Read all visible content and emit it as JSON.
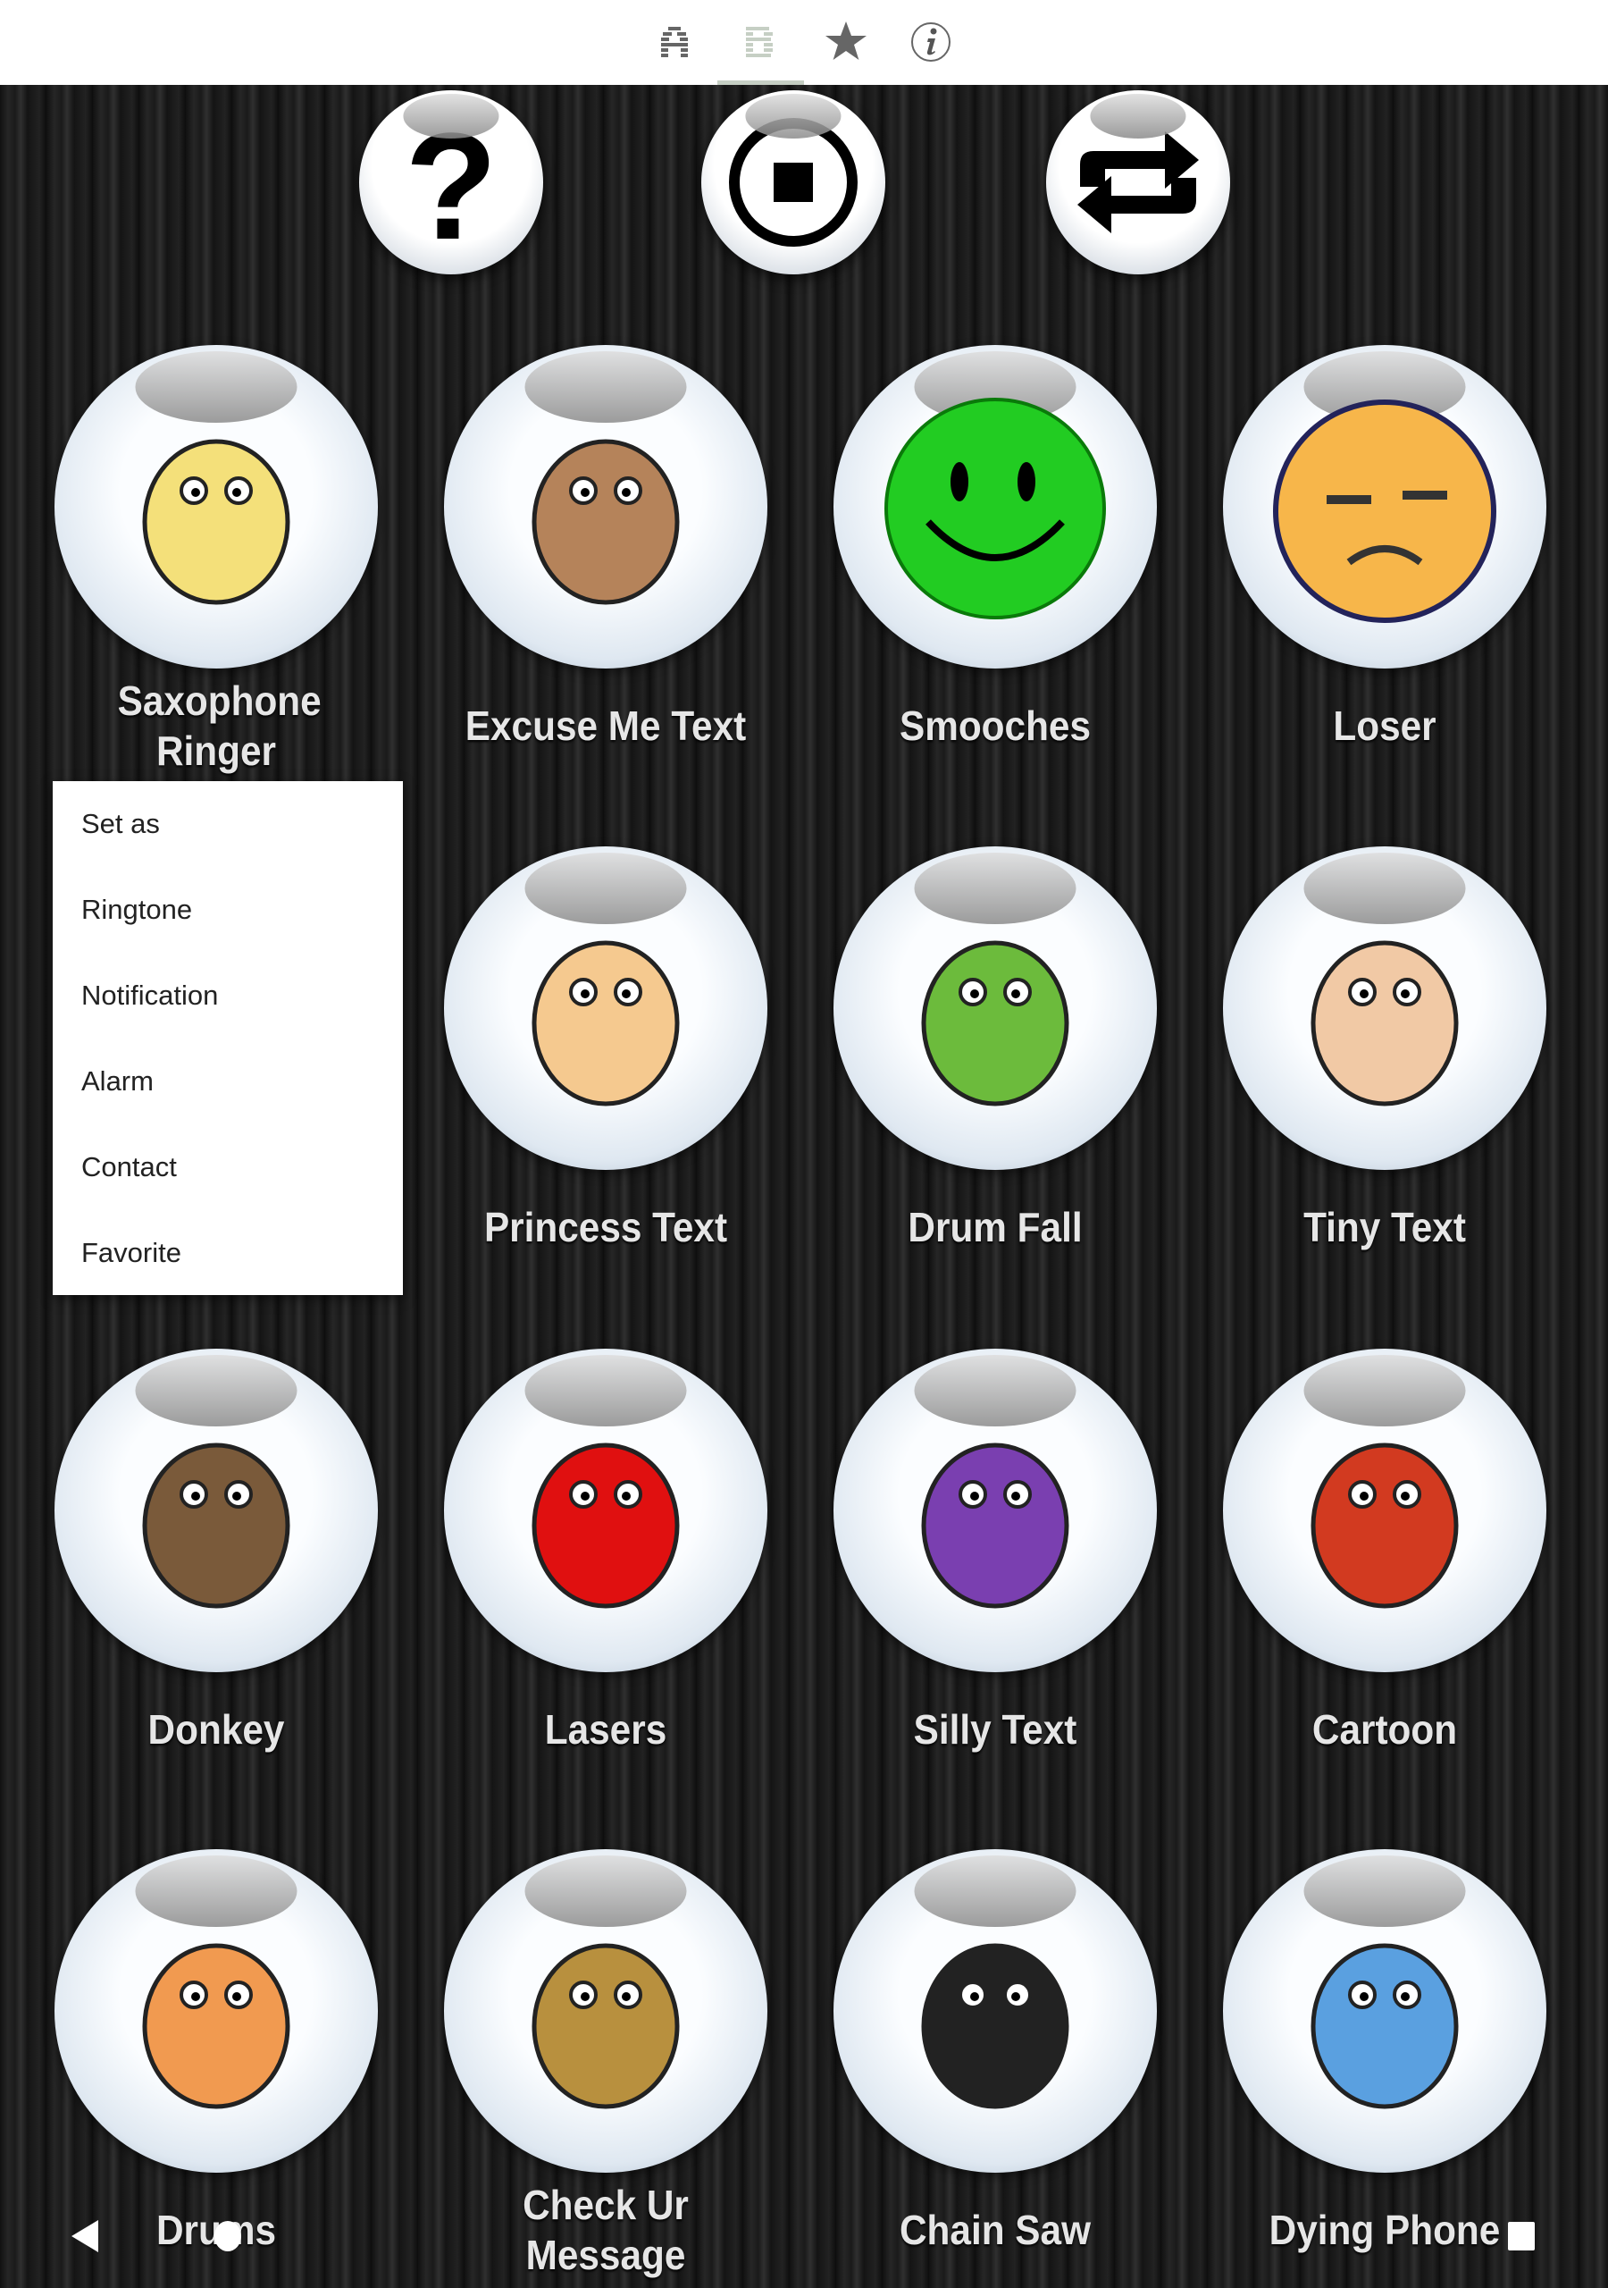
{
  "top_tabs": [
    {
      "icon": "letter-a-icon",
      "selected": false
    },
    {
      "icon": "letter-b-icon",
      "selected": true
    },
    {
      "icon": "star-icon",
      "selected": false
    },
    {
      "icon": "info-icon",
      "selected": false
    }
  ],
  "controls": [
    {
      "name": "help-button",
      "icon": "question-icon",
      "glyph": "?"
    },
    {
      "name": "stop-button",
      "icon": "stop-icon"
    },
    {
      "name": "repeat-button",
      "icon": "repeat-icon"
    }
  ],
  "sounds": [
    {
      "label": "Saxophone Ringer",
      "color": "#f4e07a"
    },
    {
      "label": "Excuse Me Text",
      "color": "#b5835a"
    },
    {
      "label": "Smooches",
      "color": "#22cc22"
    },
    {
      "label": "Loser",
      "color": "#f7b64a"
    },
    {
      "label": "",
      "color": ""
    },
    {
      "label": "Princess Text",
      "color": "#f5c98f"
    },
    {
      "label": "Drum Fall",
      "color": "#6cbb3c"
    },
    {
      "label": "Tiny Text",
      "color": "#f1c9a5"
    },
    {
      "label": "Donkey",
      "color": "#7a5a3a"
    },
    {
      "label": "Lasers",
      "color": "#e01010"
    },
    {
      "label": "Silly Text",
      "color": "#7a3fb0"
    },
    {
      "label": "Cartoon",
      "color": "#d23a20"
    },
    {
      "label": "Drums",
      "color": "#f19a50"
    },
    {
      "label": "Check Ur Message",
      "color": "#b8903e"
    },
    {
      "label": "Chain Saw",
      "color": "#222222"
    },
    {
      "label": "Dying Phone",
      "color": "#5aa0e0"
    }
  ],
  "context_menu": {
    "title": "Set as",
    "items": [
      "Ringtone",
      "Notification",
      "Alarm",
      "Contact",
      "Favorite"
    ]
  },
  "nav": {
    "back": "back-icon",
    "home": "home-icon",
    "recents": "recents-icon"
  }
}
